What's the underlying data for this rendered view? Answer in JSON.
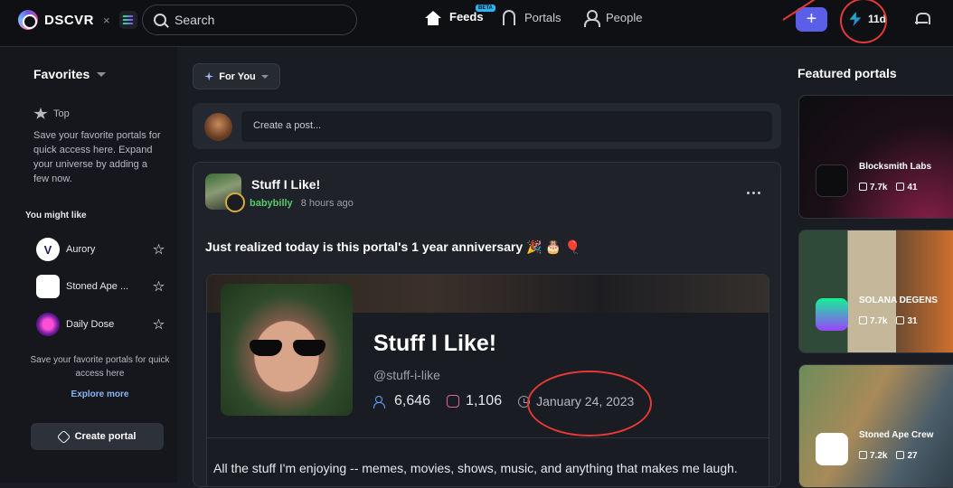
{
  "topbar": {
    "brand": "DSCVR",
    "separator": "×",
    "search_placeholder": "Search",
    "nav": [
      {
        "label": "Feeds",
        "active": true,
        "badge": "BETA"
      },
      {
        "label": "Portals",
        "active": false
      },
      {
        "label": "People",
        "active": false
      }
    ],
    "create_label": "+",
    "streak_label": "11d",
    "accent": "#5b5ee6"
  },
  "sidebar": {
    "favorites_title": "Favorites",
    "top_label": "Top",
    "favorites_desc": "Save your favorite portals for quick access here. Expand your universe by adding a few now.",
    "might_like_title": "You might like",
    "suggestions": [
      {
        "name": "Aurory",
        "icon": "aurory-logo"
      },
      {
        "name": "Stoned Ape ...",
        "icon": "stoned-ape-logo"
      },
      {
        "name": "Daily Dose",
        "icon": "daily-dose-logo"
      }
    ],
    "save_desc": "Save your favorite portals for quick access here",
    "explore_more": "Explore more",
    "create_portal": "Create portal"
  },
  "feed": {
    "filter_label": "For You",
    "create_post_placeholder": "Create a post...",
    "post": {
      "portal_title": "Stuff I Like!",
      "username": "babybilly",
      "time": "8 hours ago",
      "body": "Just realized today is this portal's 1 year anniversary 🎉 🎂 🎈",
      "embed": {
        "title": "Stuff I Like!",
        "handle": "@stuff-i-like",
        "members": "6,646",
        "posts": "1,106",
        "created": "January 24, 2023",
        "description": "All the stuff I'm enjoying -- memes, movies, shows, music, and anything that makes me laugh."
      }
    }
  },
  "featured": {
    "title": "Featured portals",
    "portals": [
      {
        "name": "Blocksmith Labs",
        "members": "7.7k",
        "posts": "41"
      },
      {
        "name": "SOLANA DEGENS",
        "members": "7.7k",
        "posts": "31"
      },
      {
        "name": "Stoned Ape Crew",
        "members": "7.2k",
        "posts": "27"
      }
    ]
  },
  "annotation_color": "#e53935"
}
